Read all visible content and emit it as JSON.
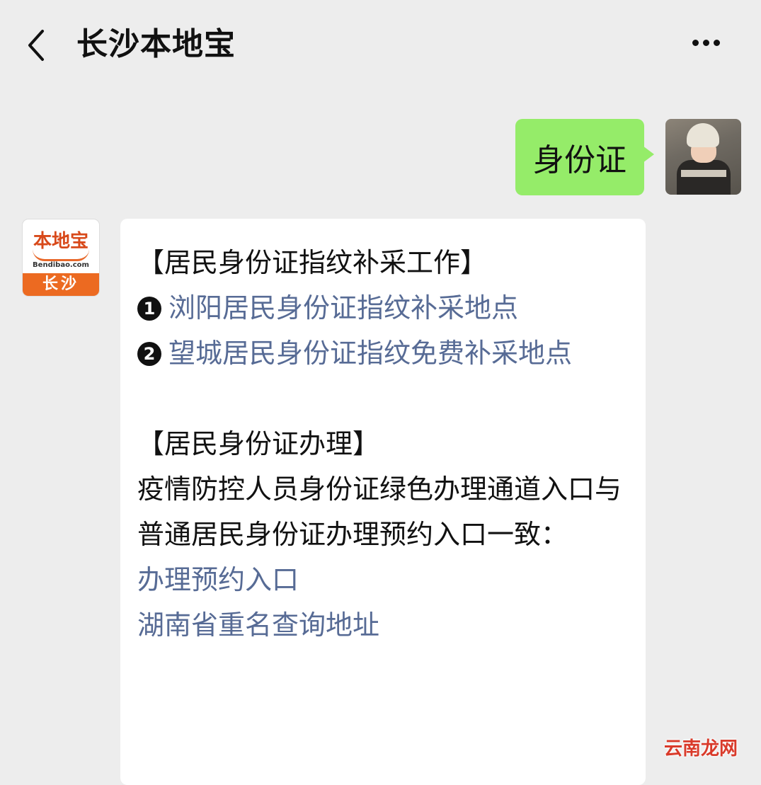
{
  "header": {
    "title": "长沙本地宝",
    "back_icon": "chevron-left-icon",
    "more_icon": "more-horizontal-icon"
  },
  "sent_message": {
    "text": "身份证"
  },
  "official_account": {
    "logo_text": "本地宝",
    "logo_domain": "Bendibao.com",
    "city": "长沙"
  },
  "reply": {
    "section1_title": "【居民身份证指纹补采工作】",
    "item1_number": "1",
    "item1_link": "浏阳居民身份证指纹补采地点",
    "item2_number": "2",
    "item2_link": "望城居民身份证指纹免费补采地点",
    "section2_title": "【居民身份证办理】",
    "body_text": "疫情防控人员身份证绿色办理通道入口与普通居民身份证办理预约入口一致：",
    "link_booking": "办理预约入口",
    "link_duplicate_name": "湖南省重名查询地址"
  },
  "watermark": "云南龙网",
  "colors": {
    "background": "#ededed",
    "sent_bubble": "#95ec69",
    "received_bubble": "#ffffff",
    "link": "#576b95",
    "brand_orange": "#ec6a21"
  }
}
